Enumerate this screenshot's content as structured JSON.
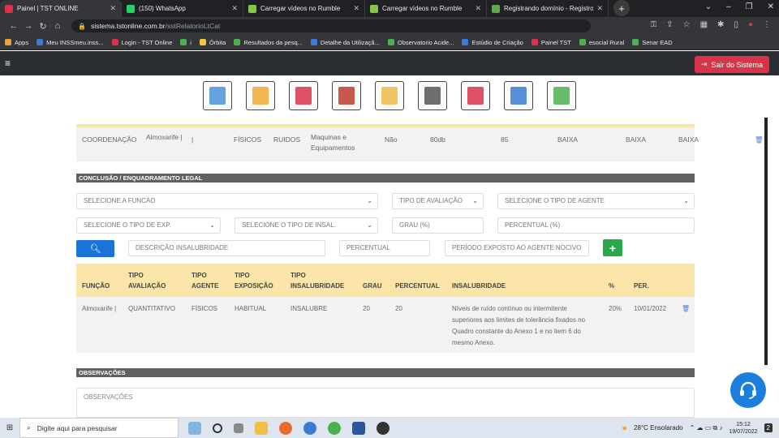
{
  "browser": {
    "tabs": [
      {
        "title": "Painel | TST ONLINE",
        "color": "#d9334a",
        "active": true
      },
      {
        "title": "(150) WhatsApp",
        "color": "#25d366",
        "active": false
      },
      {
        "title": "Carregar vídeos no Rumble",
        "color": "#85c742",
        "active": false
      },
      {
        "title": "Carregar vídeos no Rumble",
        "color": "#85c742",
        "active": false
      },
      {
        "title": "Registrando domínio - Registro.br",
        "color": "#5fa84f",
        "active": false
      }
    ],
    "url_domain": "sistema.tstonline.com.br",
    "url_path": "/sstRelatorioLtCat",
    "bookmarks": [
      {
        "label": "Apps",
        "color": "#e8a33b"
      },
      {
        "label": "Meu INSSmeu.inss...",
        "color": "#3a7bd5"
      },
      {
        "label": "Login - TST Online",
        "color": "#d9334a"
      },
      {
        "label": "i",
        "color": "#4caf50"
      },
      {
        "label": "Órbita",
        "color": "#f4c542"
      },
      {
        "label": "Resultados da pesq...",
        "color": "#4caf50"
      },
      {
        "label": "Detalhe da Utilizaçã...",
        "color": "#3a7bd5"
      },
      {
        "label": "Observatorio Acide...",
        "color": "#4caf50"
      },
      {
        "label": "Estúdio de Criação",
        "color": "#3a7bd5"
      },
      {
        "label": "Painel TST",
        "color": "#d9334a"
      },
      {
        "label": "esocial Rural",
        "color": "#4caf50"
      },
      {
        "label": "Senar EAD",
        "color": "#4caf50"
      }
    ]
  },
  "header": {
    "menu_icon": "≡",
    "logout_label": "Sair do Sistema"
  },
  "nav_icons": [
    {
      "name": "building-icon",
      "color": "#4a90d9"
    },
    {
      "name": "helmet-icon",
      "color": "#f0a830"
    },
    {
      "name": "medical-report-icon",
      "color": "#d9334a"
    },
    {
      "name": "worker-icon",
      "color": "#c0392b"
    },
    {
      "name": "folder-icon",
      "color": "#f0b94a"
    },
    {
      "name": "clipboard-icon",
      "color": "#555555"
    },
    {
      "name": "medical-clipboard-icon",
      "color": "#d9334a"
    },
    {
      "name": "doctor-icon",
      "color": "#3a7bd5"
    },
    {
      "name": "plant-hands-icon",
      "color": "#4caf50"
    }
  ],
  "top_row": {
    "cells": [
      "COORDENAÇÃO",
      "Almoxarife |",
      "|",
      "FÍSICOS",
      "RUIDOS",
      "Maquinas e Equipamentos",
      "Não",
      "80db",
      "85",
      "BAIXA",
      "BAIXA",
      "BAIXA"
    ]
  },
  "conclusao": {
    "title": "CONCLUSÃO / ENQUADRAMENTO LEGAL",
    "funcao_placeholder": "SELECIONE A FUNCAO",
    "tipo_avaliacao_placeholder": "TIPO DE AVALIAÇÃO",
    "tipo_agente_placeholder": "SELECIONE O TIPO DE AGENTE",
    "tipo_exp_placeholder": "SELECIONE O TIPO DE EXP.",
    "tipo_insal_placeholder": "SELECIONE O TIPO DE INSAL.",
    "grau_placeholder": "GRAU (%)",
    "percentual_pct_placeholder": "PERCENTUAL (%)",
    "descricao_placeholder": "DESCRIÇÃO INSALUBRIDADE",
    "percentual_placeholder": "PERCENTUAL",
    "periodo_placeholder": "PERÍODO EXPOSTO AO AGENTE NOCIVO"
  },
  "table": {
    "headers": [
      "FUNÇÃO",
      "TIPO AVALIAÇÃO",
      "TIPO AGENTE",
      "TIPO EXPOSIÇÃO",
      "TIPO INSALUBRIDADE",
      "GRAU",
      "PERCENTUAL",
      "INSALUBRIDADE",
      "%",
      "PER."
    ],
    "row": {
      "funcao": "Almoxarife |",
      "tipo_avaliacao": "QUANTITATIVO",
      "tipo_agente": "FÍSICOS",
      "tipo_exposicao": "HABITUAL",
      "tipo_insalubridade": "INSALUBRE",
      "grau": "20",
      "percentual": "20",
      "insalubridade": "Níveis de ruído contínuo ou intermitente superiores aos limites de tolerância fixados no Quadro constante do Anexo 1 e no item 6 do mesmo Anexo.",
      "pct": "20%",
      "periodo": "10/01/2022"
    }
  },
  "observacoes": {
    "title": "OBSERVAÇÕES",
    "placeholder": "OBSERVAÇÕES"
  },
  "taskbar": {
    "search_placeholder": "Digite aqui para pesquisar",
    "weather": "28°C  Ensolarado",
    "time": "15:12",
    "date": "19/07/2022",
    "notifications": "2"
  }
}
